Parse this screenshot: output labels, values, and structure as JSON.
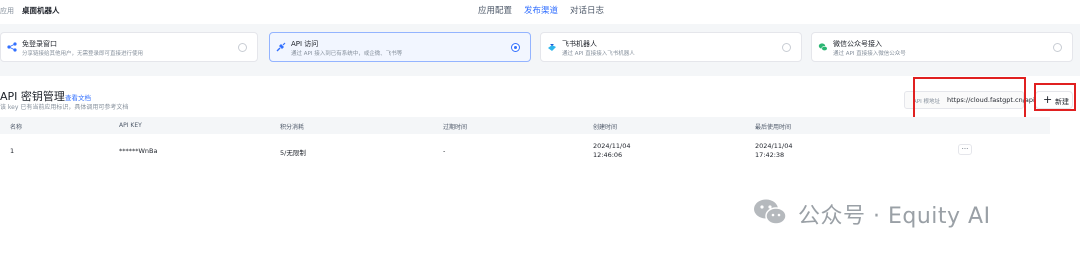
{
  "header": {
    "app_label": "应用",
    "app_name": "桌面机器人",
    "tabs": [
      {
        "label": "应用配置",
        "active": false
      },
      {
        "label": "发布渠道",
        "active": true
      },
      {
        "label": "对话日志",
        "active": false
      }
    ]
  },
  "channels": [
    {
      "title": "免登录窗口",
      "desc": "分享链接给其他用户，无需登录即可直接进行使用",
      "icon": "share-icon",
      "selected": false
    },
    {
      "title": "API 访问",
      "desc": "通过 API 接入到已有系统中，或企微、飞书等",
      "icon": "api-icon",
      "selected": true
    },
    {
      "title": "飞书机器人",
      "desc": "通过 API 直接接入飞书机器人",
      "icon": "feishu-icon",
      "selected": false
    },
    {
      "title": "微信公众号接入",
      "desc": "通过 API 直接接入微信公众号",
      "icon": "wechat-icon",
      "selected": false
    }
  ],
  "api_section": {
    "title": "API 密钥管理",
    "doc_link": "查看文档",
    "desc": "该 key 已有当前应用标识，具体调用可参考文档",
    "base_url_label": "API 根地址",
    "base_url": "https://cloud.fastgpt.cn/api",
    "new_button": "新建"
  },
  "table": {
    "columns": [
      "名称",
      "API KEY",
      "积分消耗",
      "过期时间",
      "创建时间",
      "最后使用时间"
    ],
    "rows": [
      {
        "name": "1",
        "api_key": "******WnBa",
        "points": "5/无限制",
        "expire": "-",
        "created_date": "2024/11/04",
        "created_time": "12:46:06",
        "last_used_date": "2024/11/04",
        "last_used_time": "17:42:38",
        "more": "···"
      }
    ]
  },
  "watermark": {
    "text": "公众号 · Equity AI",
    "icon": "wechat-logo-icon"
  },
  "colors": {
    "accent": "#3370ff",
    "highlight_box": "#e02020"
  }
}
